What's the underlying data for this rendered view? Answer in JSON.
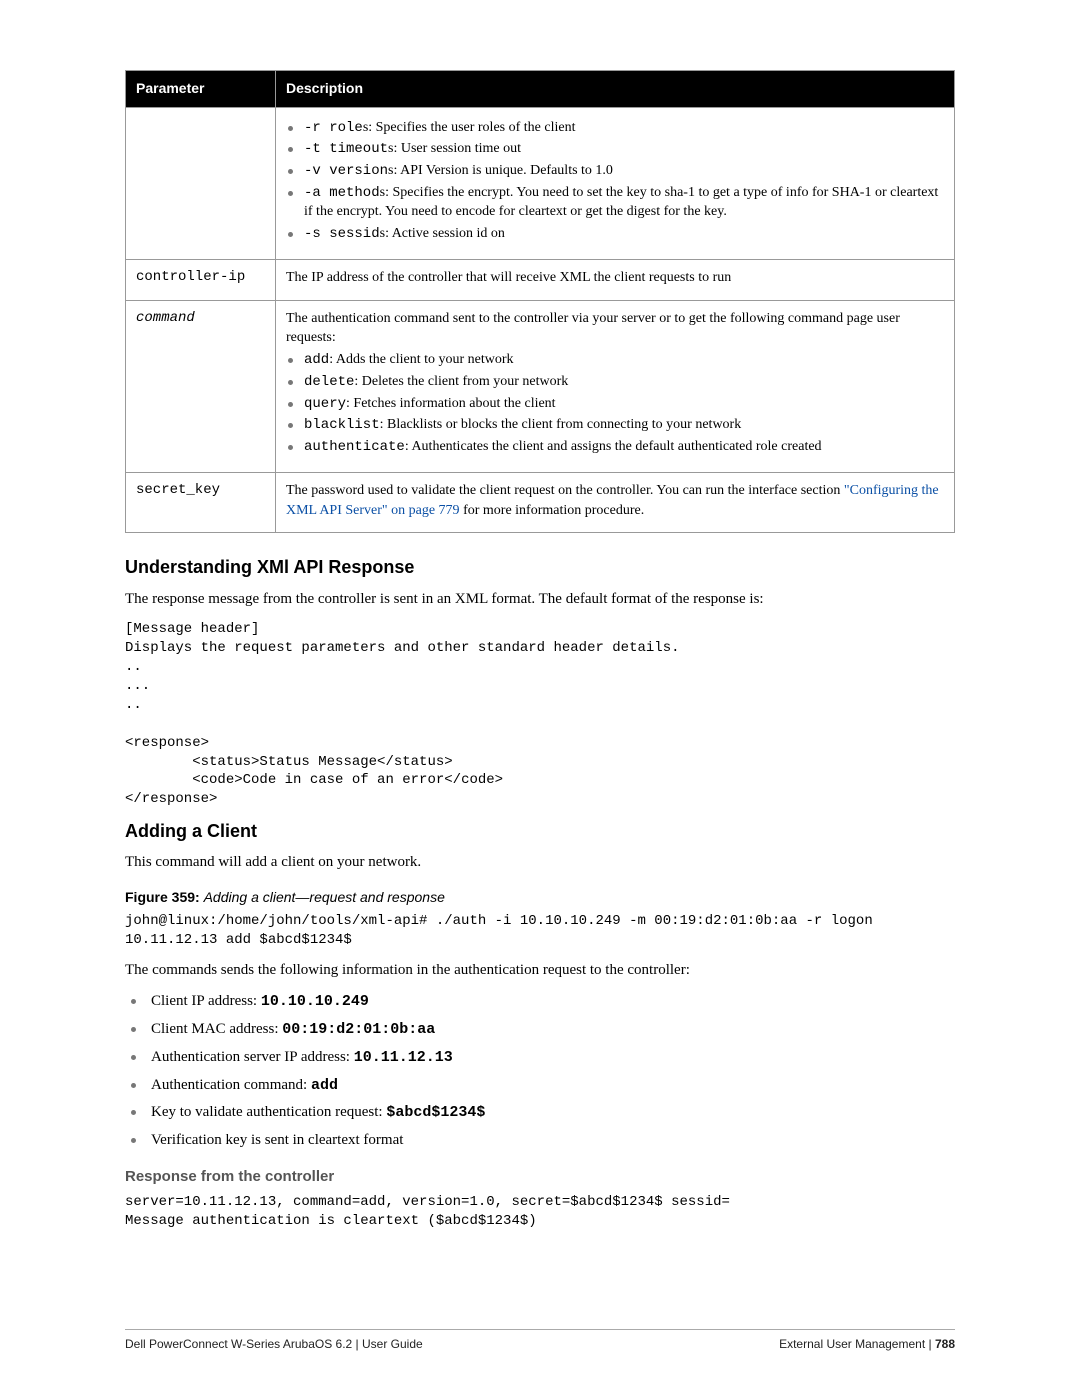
{
  "table": {
    "headers": [
      "Parameter",
      "Description"
    ],
    "rows": [
      {
        "param": "",
        "items": [
          {
            "code": "-r role",
            "text": "s: Specifies the user roles of the client"
          },
          {
            "code": "-t timeout",
            "text": "s: User session time out"
          },
          {
            "code": "-v version",
            "text": "s: API Version is unique. Defaults to 1.0"
          },
          {
            "code": "-a method",
            "text": "s: Specifies the encrypt. You need to set the key to sha-1 to get a type of info for SHA-1 or cleartext if the encrypt. You need to encode for cleartext or get the digest for the key."
          },
          {
            "code": "-s sessid",
            "text": "s: Active session id on"
          }
        ]
      },
      {
        "param": "controller-ip",
        "text": "The IP address of the controller that will receive XML the client requests to run"
      },
      {
        "param": "command",
        "paramItalic": true,
        "intro": "The authentication command sent to the controller via your server or to get the following command page user requests:",
        "items": [
          {
            "code": "add",
            "text": ": Adds the client to your network"
          },
          {
            "code": "delete",
            "text": ": Deletes the client from your network"
          },
          {
            "code": "query",
            "text": ": Fetches information about the client"
          },
          {
            "code": "blacklist",
            "text": ": Blacklists or blocks the client from connecting to your network"
          },
          {
            "code": "authenticate",
            "text": ": Authenticates the client and assigns the default authenticated role created"
          }
        ]
      },
      {
        "param": "secret_key",
        "text_before": "The password used to validate the client request on the controller. You can run the interface section",
        "link": "\"Configuring the XML API Server\" on page 779",
        "text_after": " for more information procedure."
      }
    ]
  },
  "section1": {
    "heading": "Understanding XMl API Response",
    "intro": "The response message from the controller is sent in an XML format. The default format of the response is:",
    "code": "[Message header]\nDisplays the request parameters and other standard header details.\n..\n...\n..\n\n<response>\n        <status>Status Message</status>\n        <code>Code in case of an error</code>\n</response>"
  },
  "section2": {
    "heading": "Adding a Client",
    "intro": "This command will add a client on your network.",
    "figure_label": "Figure 359:",
    "figure_text": "Adding a client—request and response",
    "code1": "john@linux:/home/john/tools/xml-api# ./auth -i 10.10.10.249 -m 00:19:d2:01:0b:aa -r logon 10.11.12.13 add $abcd$1234$",
    "desc": "The commands sends the following information in the authentication request to the controller:",
    "list": [
      {
        "t": "Client IP address:",
        "v": "10.10.10.249"
      },
      {
        "t": "Client MAC address:",
        "v": "00:19:d2:01:0b:aa"
      },
      {
        "t": "Authentication server IP address:",
        "v": "10.11.12.13"
      },
      {
        "t": "Authentication command:",
        "v": "add"
      },
      {
        "t": "Key to validate authentication request:",
        "v": "$abcd$1234$"
      },
      {
        "t": "Verification key is sent in cleartext format",
        "v": ""
      }
    ],
    "subheading": "Response from the controller",
    "code2": "server=10.11.12.13, command=add, version=1.0, secret=$abcd$1234$ sessid=\nMessage authentication is cleartext ($abcd$1234$)"
  },
  "footer": {
    "left": "Dell PowerConnect W-Series ArubaOS 6.2  |  User Guide",
    "right_a": "External User Management",
    "right_b": "788"
  }
}
